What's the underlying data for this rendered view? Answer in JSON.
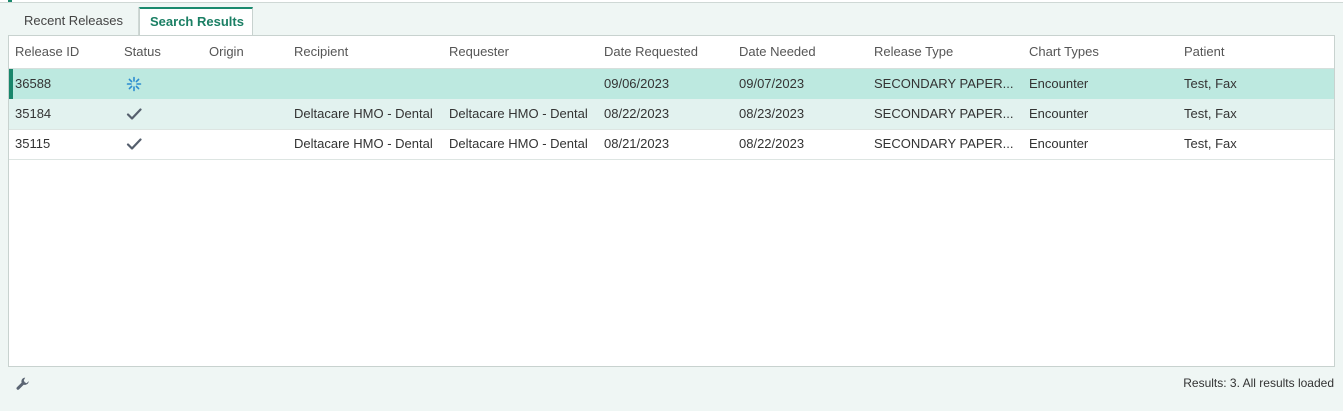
{
  "tabs": [
    {
      "label": "Recent Releases",
      "active": false
    },
    {
      "label": "Search Results",
      "active": true
    }
  ],
  "columns": {
    "release_id": "Release ID",
    "status": "Status",
    "origin": "Origin",
    "recipient": "Recipient",
    "requester": "Requester",
    "date_requested": "Date Requested",
    "date_needed": "Date Needed",
    "release_type": "Release Type",
    "chart_types": "Chart Types",
    "patient": "Patient"
  },
  "rows": [
    {
      "release_id": "36588",
      "status_icon": "spinner-icon",
      "origin": "",
      "recipient": "",
      "requester": "",
      "date_requested": "09/06/2023",
      "date_needed": "09/07/2023",
      "release_type": "SECONDARY PAPER...",
      "chart_types": "Encounter",
      "patient": "Test, Fax",
      "selected": true
    },
    {
      "release_id": "35184",
      "status_icon": "checkmark-icon",
      "origin": "",
      "recipient": "Deltacare HMO - Dental",
      "requester": "Deltacare HMO - Dental",
      "date_requested": "08/22/2023",
      "date_needed": "08/23/2023",
      "release_type": "SECONDARY PAPER...",
      "chart_types": "Encounter",
      "patient": "Test, Fax"
    },
    {
      "release_id": "35115",
      "status_icon": "checkmark-icon",
      "origin": "",
      "recipient": "Deltacare HMO - Dental",
      "requester": "Deltacare HMO - Dental",
      "date_requested": "08/21/2023",
      "date_needed": "08/22/2023",
      "release_type": "SECONDARY PAPER...",
      "chart_types": "Encounter",
      "patient": "Test, Fax"
    }
  ],
  "footer": {
    "tool_icon": "wrench-icon",
    "results_text": "Results: 3. All results loaded"
  },
  "colors": {
    "accent": "#1a8a6e",
    "selected_row": "#bde9e0",
    "alt_row": "#e2f2ef",
    "spinner": "#2a8bd0",
    "check": "#555f6d"
  }
}
